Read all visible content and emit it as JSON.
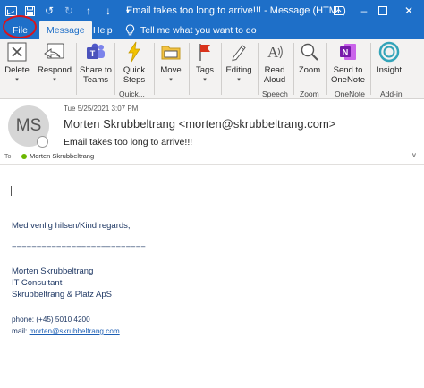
{
  "window": {
    "title": "Email takes too long to arrive!!!  -  Message (HTML)"
  },
  "tabs": [
    {
      "label": "File"
    },
    {
      "label": "Message"
    },
    {
      "label": "Help"
    }
  ],
  "tell_me": "Tell me what you want to do",
  "ribbon": {
    "delete": "Delete",
    "respond": "Respond",
    "share_to_teams": [
      "Share to",
      "Teams"
    ],
    "quick_steps": [
      "Quick",
      "Steps"
    ],
    "move": "Move",
    "tags": "Tags",
    "editing": "Editing",
    "read_aloud": [
      "Read",
      "Aloud"
    ],
    "zoom": "Zoom",
    "send_to_onenote": [
      "Send to",
      "OneNote"
    ],
    "insights": "Insight",
    "groups": {
      "quick": "Quick...",
      "speech": "Speech",
      "zoom": "Zoom",
      "onenote": "OneNote",
      "addin": "Add-in"
    }
  },
  "message": {
    "avatar_initials": "MS",
    "date": "Tue 5/25/2021 3:07 PM",
    "from": "Morten Skrubbeltrang <morten@skrubbeltrang.com>",
    "subject": "Email takes too long to arrive!!!",
    "to_label": "To",
    "to": "Morten Skrubbeltrang"
  },
  "body": {
    "regards": "Med venlig hilsen/Kind regards,",
    "separator": "===========================",
    "name": "Morten Skrubbeltrang",
    "role": "IT Consultant",
    "company": "Skrubbeltrang & Platz ApS",
    "phone": "phone: (+45) 5010 4200",
    "mail_label": "mail: ",
    "mail": "morten@skrubbeltrang.com"
  },
  "colors": {
    "titlebar": "#1e6fc8",
    "ribbon": "#f3f2f1",
    "highlight_circle": "#d9141c",
    "body_text": "#1f3864"
  }
}
